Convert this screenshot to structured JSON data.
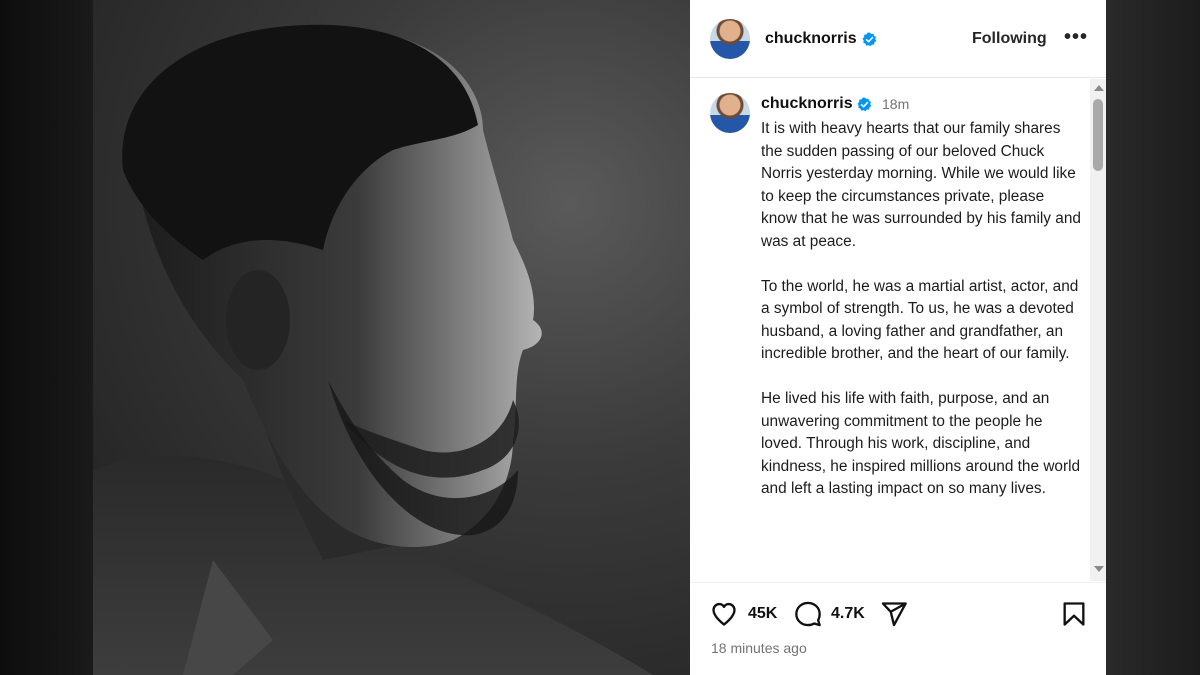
{
  "post": {
    "username": "chucknorris",
    "follow_label": "Following",
    "more_label": "•••",
    "time_short": "18m",
    "time_long": "18 minutes ago",
    "likes": "45K",
    "comments": "4.7K",
    "caption": [
      "It is with heavy hearts that our family shares the sudden passing of our beloved Chuck Norris yesterday morning. While we would like to keep the circumstances private, please know that he was surrounded by his family and was at peace.",
      "To the world, he was a martial artist, actor, and a symbol of strength. To us, he was a devoted husband, a loving father and grandfather, an incredible brother, and the heart of our family.",
      "He lived his life with faith, purpose, and an unwavering commitment to the people he loved. Through his work, discipline, and kindness, he inspired millions around the world and left a lasting impact on so many lives."
    ]
  },
  "icons": {
    "verified": "verified-badge-icon",
    "like": "heart-icon",
    "comment": "comment-bubble-icon",
    "share": "paper-plane-icon",
    "save": "bookmark-icon"
  },
  "colors": {
    "verified": "#0095f6",
    "text": "#111111",
    "secondary": "#737373"
  }
}
